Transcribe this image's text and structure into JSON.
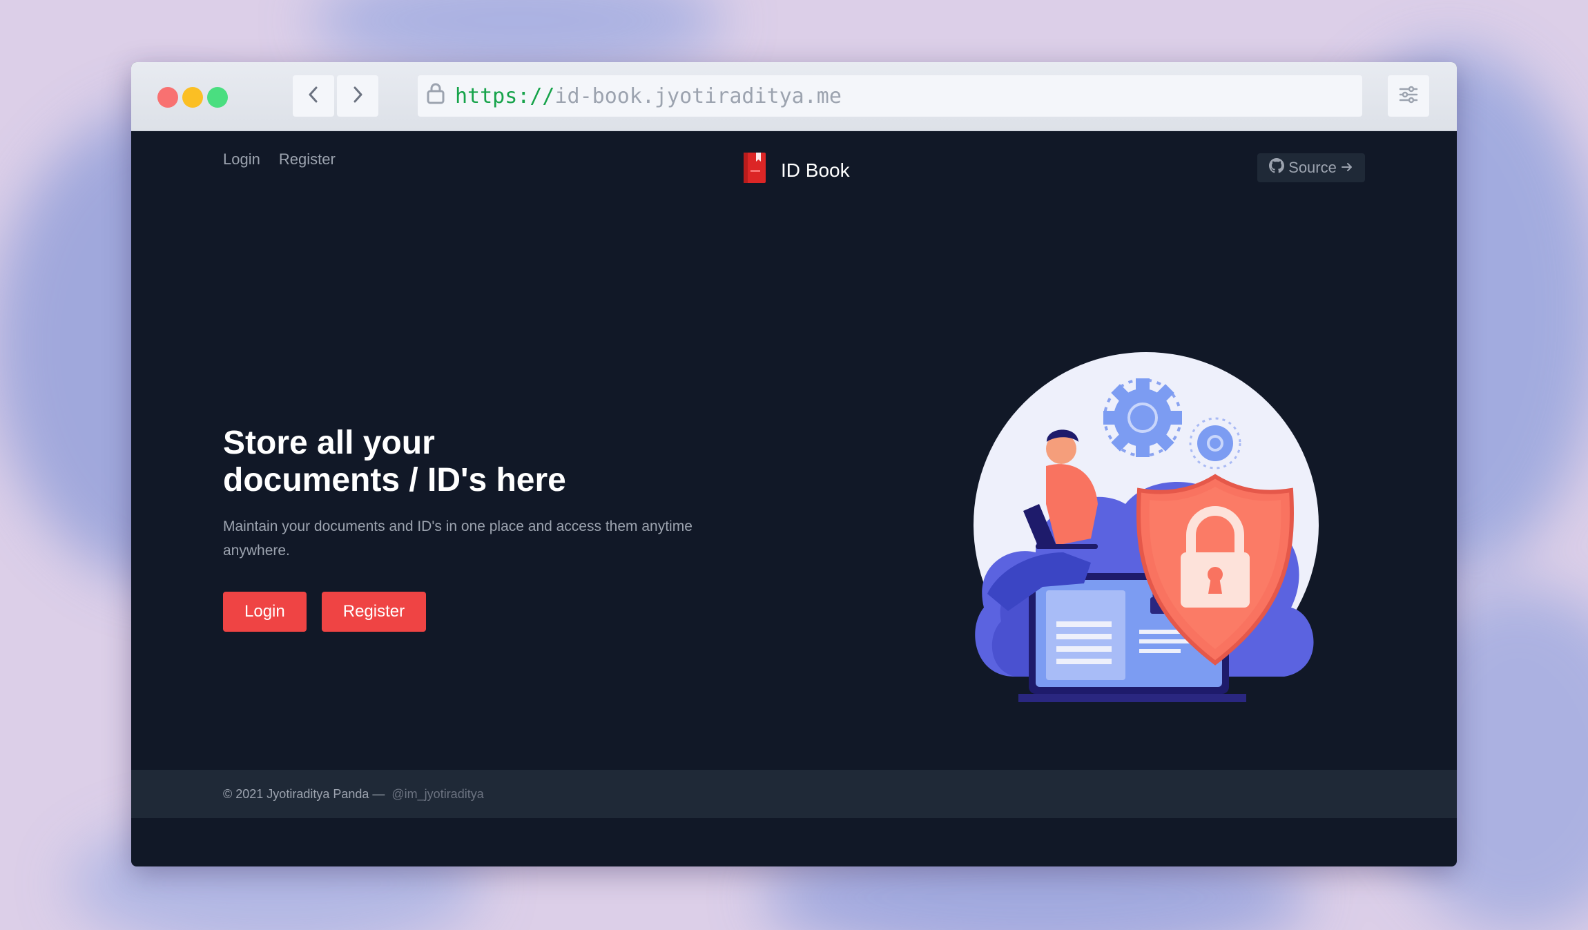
{
  "browser": {
    "url_scheme": "https://",
    "url_host": "id-book.jyotiraditya.me",
    "icons": {
      "back": "chevron-left-icon",
      "forward": "chevron-right-icon",
      "lock": "lock-icon",
      "menu": "sliders-icon"
    }
  },
  "nav": {
    "login": "Login",
    "register": "Register",
    "brand": "ID Book",
    "source": "Source"
  },
  "hero": {
    "title_line1": "Store all your",
    "title_line2": "documents / ID's here",
    "description": "Maintain your documents and ID's in one place and access them anytime anywhere.",
    "login_button": "Login",
    "register_button": "Register"
  },
  "footer": {
    "copyright": "© 2021 Jyotiraditya Panda —",
    "handle": "@im_jyotiraditya"
  },
  "colors": {
    "page_bg": "#111827",
    "footer_bg": "#1f2937",
    "accent": "#ef4444",
    "url_scheme": "#16a34a"
  }
}
